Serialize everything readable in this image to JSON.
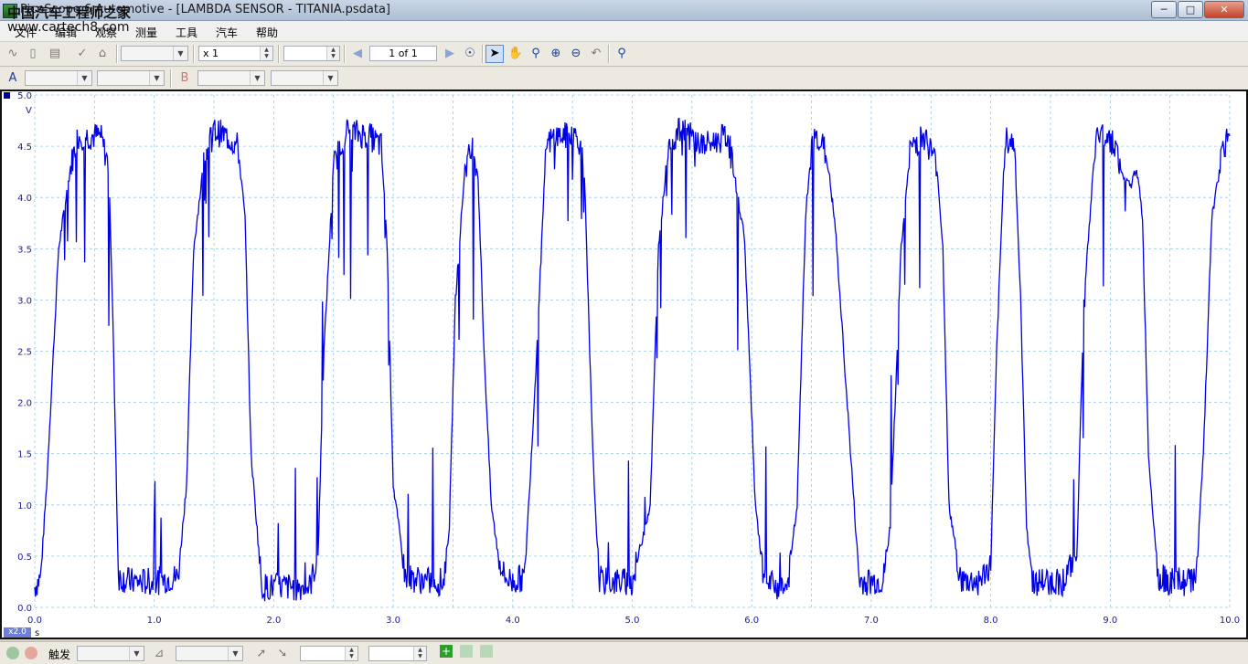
{
  "window": {
    "title": "PicoScope 6 Automotive - [LAMBDA SENSOR - TITANIA.psdata]",
    "watermark_line1": "中国汽车工程师之家",
    "watermark_line2": "www.cartech8.com"
  },
  "menu": [
    "文件",
    "编辑",
    "观察",
    "测量",
    "工具",
    "汽车",
    "帮助"
  ],
  "toolbar": {
    "multiplier": "x 1",
    "page_indicator": "1 of 1"
  },
  "scope": {
    "y_unit": "V",
    "x_unit": "s",
    "x_scale_badge": "x2.0",
    "trace_color": "#0000e6",
    "grid_color": "#9ec8dc"
  },
  "chart_data": {
    "type": "line",
    "ylabel": "V",
    "xlabel": "s",
    "xlim": [
      0.0,
      10.0
    ],
    "ylim": [
      0.0,
      5.0
    ],
    "yticks": [
      "5.0",
      "4.5",
      "4.0",
      "3.5",
      "3.0",
      "2.5",
      "2.0",
      "1.5",
      "1.0",
      "0.5",
      "0.0"
    ],
    "xticks": [
      "0.0",
      "1.0",
      "2.0",
      "3.0",
      "4.0",
      "5.0",
      "6.0",
      "7.0",
      "8.0",
      "9.0",
      "10.0"
    ],
    "grid": true,
    "series": [
      {
        "x": [
          0.0,
          0.05,
          0.1,
          0.2,
          0.3,
          0.36,
          0.45,
          0.55,
          0.62,
          0.66,
          0.7,
          0.8,
          1.0,
          1.2,
          1.27,
          1.33,
          1.42,
          1.5,
          1.6,
          1.7,
          1.76,
          1.81,
          1.9,
          2.1,
          2.3,
          2.37,
          2.42,
          2.5,
          2.6,
          2.8,
          2.9,
          2.95,
          3.0,
          3.1,
          3.3,
          3.42,
          3.47,
          3.52,
          3.6,
          3.67,
          3.71,
          3.76,
          3.82,
          3.88,
          3.93,
          4.0,
          4.1,
          4.18,
          4.28,
          4.35,
          4.45,
          4.55,
          4.6,
          4.67,
          4.72,
          4.75,
          4.85,
          5.0,
          5.15,
          5.22,
          5.3,
          5.43,
          5.48,
          5.6,
          5.8,
          5.94,
          6.03,
          6.1,
          6.2,
          6.3,
          6.38,
          6.45,
          6.5,
          6.55,
          6.6,
          6.64,
          6.7,
          6.9,
          7.1,
          7.16,
          7.25,
          7.33,
          7.45,
          7.55,
          7.6,
          7.65,
          7.75,
          7.9,
          8.0,
          8.05,
          8.12,
          8.2,
          8.25,
          8.3,
          8.35,
          8.45,
          8.6,
          8.72,
          8.78,
          8.88,
          8.98,
          9.05,
          9.1,
          9.17,
          9.22,
          9.27,
          9.32,
          9.4,
          9.5,
          9.65,
          9.72,
          9.78,
          9.85,
          9.95,
          10.0
        ],
        "y": [
          0.2,
          0.3,
          1.2,
          3.5,
          4.3,
          4.6,
          4.6,
          4.6,
          4.3,
          2.5,
          0.3,
          0.25,
          0.25,
          0.3,
          1.2,
          3.5,
          4.4,
          4.65,
          4.6,
          4.5,
          3.8,
          1.5,
          0.2,
          0.2,
          0.2,
          0.5,
          2.5,
          4.3,
          4.65,
          4.6,
          4.5,
          3.5,
          1.2,
          0.3,
          0.25,
          0.25,
          0.8,
          3.0,
          4.3,
          4.5,
          4.2,
          2.5,
          1.0,
          0.5,
          0.3,
          0.25,
          0.3,
          2.0,
          4.5,
          4.6,
          4.6,
          4.6,
          4.2,
          1.5,
          0.3,
          0.25,
          0.25,
          0.25,
          1.0,
          3.5,
          4.5,
          4.7,
          4.6,
          4.5,
          4.6,
          3.6,
          1.0,
          0.25,
          0.2,
          0.2,
          1.0,
          3.8,
          4.5,
          4.6,
          4.5,
          4.3,
          3.7,
          0.25,
          0.25,
          0.8,
          3.5,
          4.5,
          4.6,
          4.3,
          3.5,
          1.0,
          0.25,
          0.25,
          0.4,
          2.5,
          4.6,
          4.5,
          3.0,
          0.8,
          0.25,
          0.25,
          0.25,
          0.5,
          3.0,
          4.6,
          4.6,
          4.5,
          4.2,
          4.1,
          4.3,
          3.8,
          1.5,
          0.3,
          0.25,
          0.25,
          0.3,
          1.5,
          3.8,
          4.5,
          4.6
        ]
      }
    ]
  },
  "bottom": {
    "trigger_label": "触发"
  }
}
